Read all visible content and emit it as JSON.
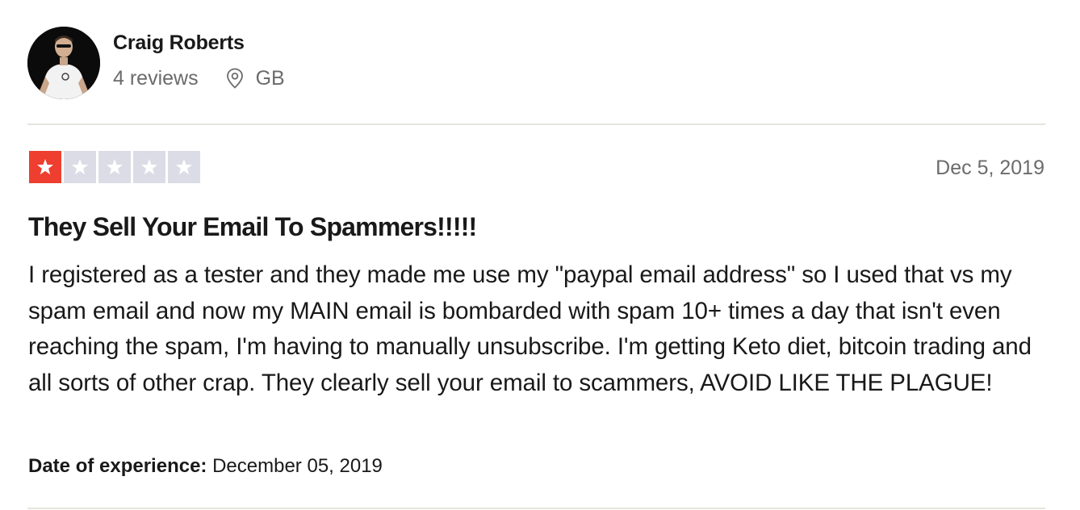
{
  "consumer": {
    "name": "Craig Roberts",
    "reviews_count": "4 reviews",
    "country": "GB"
  },
  "review": {
    "rating": 1,
    "max_rating": 5,
    "date": "Dec 5, 2019",
    "title": "They Sell Your Email To Spammers!!!!!",
    "body": "I registered as a tester and they made me use my \"paypal email address\" so I used that vs my spam email and now my MAIN email is bombarded with spam 10+ times a day that isn't even reaching the spam, I'm having to manually unsubscribe. I'm getting Keto diet, bitcoin trading and all sorts of other crap. They clearly sell your email to scammers, AVOID LIKE THE PLAGUE!",
    "experience_label": "Date of experience:",
    "experience_date": "December 05, 2019"
  },
  "colors": {
    "star_filled": "#ee3e2f",
    "star_empty": "#dcdce6",
    "muted_text": "#6b6b6b"
  },
  "icons": {
    "location": "map-pin-icon",
    "star": "star-icon"
  }
}
